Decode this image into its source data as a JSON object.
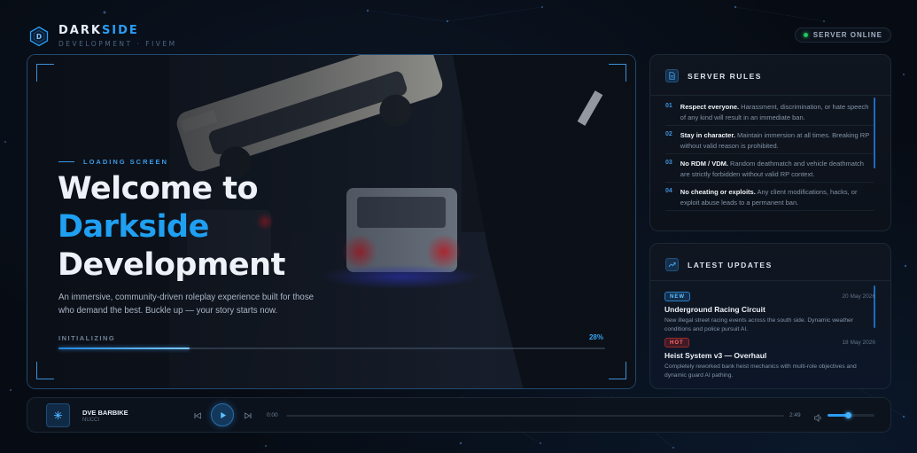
{
  "brand": {
    "name_main": "DARK",
    "name_accent": "SIDE",
    "subtitle": "DEVELOPMENT · FIVEM",
    "logo_letter": "D"
  },
  "status": {
    "label": "SERVER ONLINE",
    "color": "#22c55e"
  },
  "hero": {
    "eyebrow": "LOADING SCREEN",
    "title_line1": "Welcome to",
    "title_line2": "Darkside",
    "title_line3": "Development",
    "description": "An immersive, community-driven roleplay experience built for those who demand the best. Buckle up — your story starts now.",
    "progress_label": "INITIALIZING",
    "progress_text": "28%",
    "progress_value": 0.24
  },
  "rules": {
    "title": "SERVER RULES",
    "icon": "document-icon",
    "items": [
      {
        "num": "01",
        "bold": "Respect everyone.",
        "text": " Harassment, discrimination, or hate speech of any kind will result in an immediate ban."
      },
      {
        "num": "02",
        "bold": "Stay in character.",
        "text": " Maintain immersion at all times. Breaking RP without valid reason is prohibited."
      },
      {
        "num": "03",
        "bold": "No RDM / VDM.",
        "text": " Random deathmatch and vehicle deathmatch are strictly forbidden without valid RP context."
      },
      {
        "num": "04",
        "bold": "No cheating or exploits.",
        "text": " Any client modifications, hacks, or exploit abuse leads to a permanent ban."
      }
    ]
  },
  "updates": {
    "title": "LATEST UPDATES",
    "icon": "trending-up-icon",
    "items": [
      {
        "badge": "NEW",
        "date": "20 May 2026",
        "title": "Underground Racing Circuit",
        "desc": "New illegal street racing events across the south side. Dynamic weather conditions and police pursuit AI."
      },
      {
        "badge": "HOT",
        "date": "18 May 2026",
        "title": "Heist System v3 — Overhaul",
        "desc": "Completely reworked bank heist mechanics with multi-role objectives and dynamic guard AI pathing."
      }
    ]
  },
  "player": {
    "track_title": "DVE BARBIKE",
    "track_artist": "NUCCI",
    "time_current": "0:00",
    "time_total": "2:49",
    "volume": 0.45,
    "accent": "#2a9df4"
  }
}
